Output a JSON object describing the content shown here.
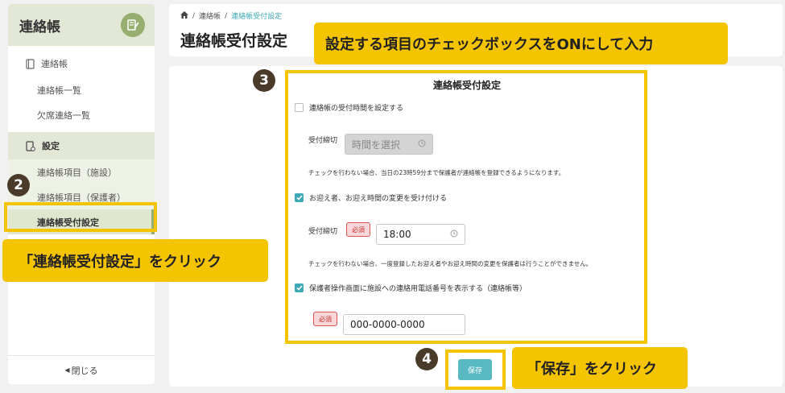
{
  "sidebar": {
    "title": "連絡帳",
    "sections": [
      {
        "label": "連絡帳",
        "items": [
          "連絡帳一覧",
          "欠席連絡一覧"
        ]
      },
      {
        "label": "設定",
        "items": [
          "連絡帳項目（施設）",
          "連絡帳項目（保護者）",
          "連絡帳受付設定"
        ]
      }
    ],
    "close_label": "閉じる"
  },
  "breadcrumb": [
    "連絡帳",
    "連絡帳受付設定"
  ],
  "page_title": "連絡帳受付設定",
  "form": {
    "title": "連絡帳受付設定",
    "option1": {
      "label": "連絡帳の受付時間を設定する",
      "checked": false,
      "field_label": "受付締切",
      "placeholder": "時間を選択",
      "note": "チェックを行わない場合、当日の23時59分まで保護者が連絡帳を登録できるようになります。"
    },
    "option2": {
      "label": "お迎え者、お迎え時間の変更を受け付ける",
      "checked": true,
      "field_label": "受付締切",
      "required": "必須",
      "value": "18:00",
      "note": "チェックを行わない場合、一度登録したお迎え者やお迎え時間の変更を保護者は行うことができません。"
    },
    "option3": {
      "label": "保護者操作画面に施設への連絡用電話番号を表示する（連絡帳等）",
      "checked": true,
      "required": "必須",
      "value": "000-0000-0000"
    },
    "save_label": "保存"
  },
  "annotations": {
    "callout_top": "設定する項目のチェックボックスをONにして入力",
    "callout_left": "「連絡帳受付設定」をクリック",
    "callout_save": "「保存」をクリック",
    "step2": "2",
    "step3": "3",
    "step4": "4"
  },
  "colors": {
    "accent": "#3fa9b5",
    "sidebar_green": "#97ae71",
    "highlight": "#f5c400",
    "required_red": "#d9534f"
  }
}
